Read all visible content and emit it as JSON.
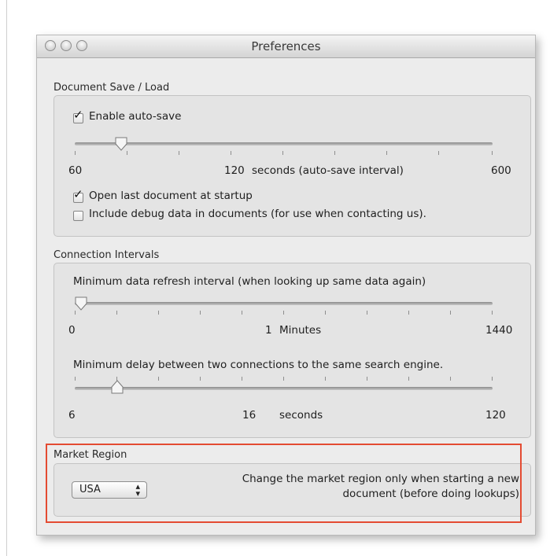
{
  "window": {
    "title": "Preferences"
  },
  "document_save_load": {
    "heading": "Document Save / Load",
    "enable_autosave": {
      "label": "Enable auto-save",
      "checked": true
    },
    "autosave_slider": {
      "min_label": "60",
      "mid_label": "120",
      "max_label": "600",
      "unit_label": "seconds (auto-save interval)",
      "value": 120
    },
    "open_last": {
      "label": "Open last document at startup",
      "checked": true
    },
    "debug_data": {
      "label": "Include debug data in documents (for use when contacting us).",
      "checked": false
    }
  },
  "connection_intervals": {
    "heading": "Connection Intervals",
    "refresh": {
      "label": "Minimum data refresh interval (when looking up same data again)",
      "min_label": "0",
      "mid_label": "1",
      "max_label": "1440",
      "unit_label": "Minutes",
      "value": 1
    },
    "delay": {
      "label": "Minimum delay between two connections to the same search engine.",
      "min_label": "6",
      "mid_label": "16",
      "max_label": "120",
      "unit_label": "seconds",
      "value": 16
    }
  },
  "market_region": {
    "heading": "Market Region",
    "selected": "USA",
    "note_line1": "Change the market region only when starting a new",
    "note_line2": "document (before doing lookups)"
  },
  "colors": {
    "highlight": "#e44b32",
    "window_bg": "#ececec"
  },
  "icons": {
    "checkbox_checked": "checkmark-icon",
    "select_arrows": "up-down-arrows-icon"
  }
}
